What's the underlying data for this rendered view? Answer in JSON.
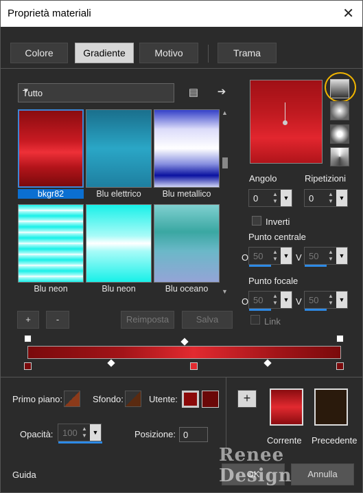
{
  "title": "Proprietà materiali",
  "tabs": [
    {
      "label": "Colore"
    },
    {
      "label": "Gradiente"
    },
    {
      "label": "Motivo"
    },
    {
      "label": "Trama"
    }
  ],
  "filter": {
    "value": "Tutto"
  },
  "gradients": [
    {
      "label": "bkgr82",
      "selected": true
    },
    {
      "label": "Blu elettrico"
    },
    {
      "label": "Blu metallico"
    },
    {
      "label": "Blu neon"
    },
    {
      "label": "Blu neon"
    },
    {
      "label": "Blu oceano"
    }
  ],
  "buttons": {
    "add": "+",
    "remove": "-",
    "reset": "Reimposta",
    "save": "Salva"
  },
  "angle": {
    "label": "Angolo",
    "value": "0"
  },
  "repeats": {
    "label": "Ripetizioni",
    "value": "0"
  },
  "invert": {
    "label": "Inverti"
  },
  "center": {
    "label": "Punto centrale",
    "h_label": "O",
    "h_value": "50",
    "v_label": "V",
    "v_value": "50"
  },
  "focal": {
    "label": "Punto focale",
    "h_label": "O",
    "h_value": "50",
    "v_label": "V",
    "v_value": "50"
  },
  "link": {
    "label": "Link"
  },
  "bottom": {
    "foreground_label": "Primo piano:",
    "background_label": "Sfondo:",
    "user_label": "Utente:",
    "opacity_label": "Opacità:",
    "opacity_value": "100",
    "position_label": "Posizione:",
    "position_value": "0",
    "current_label": "Corrente",
    "previous_label": "Precedente",
    "help": "Guida",
    "ok": "OK",
    "cancel": "Annulla"
  },
  "watermark": "Renee Design",
  "colors": {
    "accent": "#0b6fd1",
    "stop_dark": "#7a0a0c",
    "stop_user": "#8b0a0a",
    "previous": "#2a1a0c",
    "highlight_ring": "#f0b400"
  }
}
